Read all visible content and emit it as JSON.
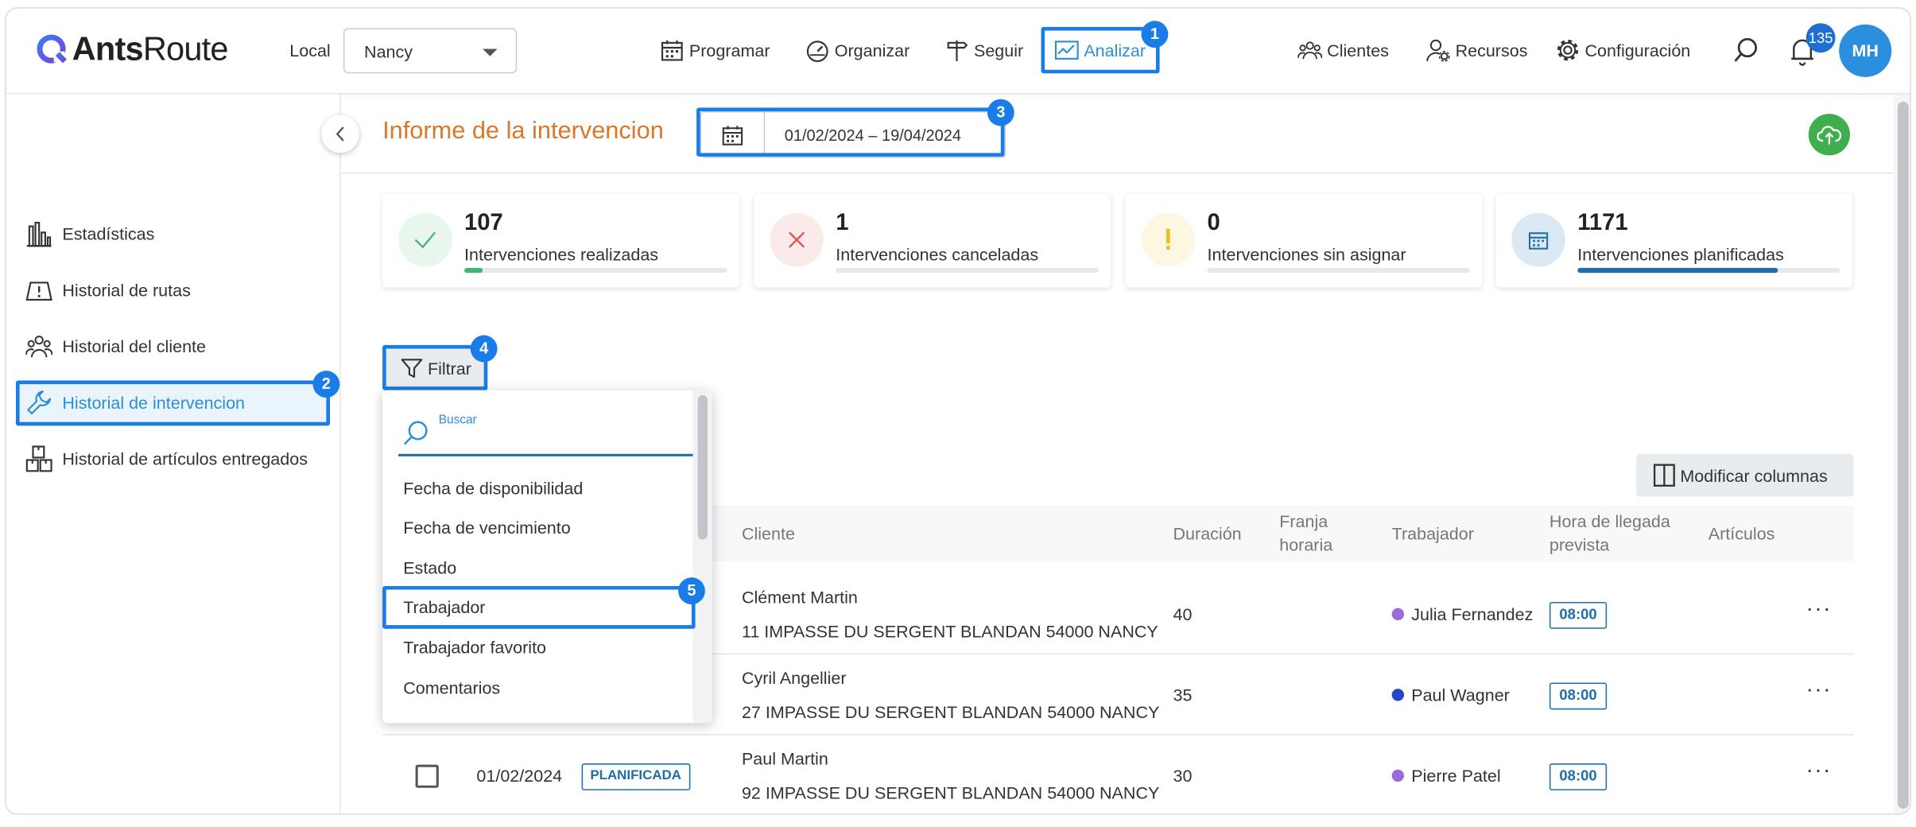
{
  "app": {
    "logo_part1": "Ants",
    "logo_part2": "Route",
    "local_label": "Local",
    "local_value": "Nancy"
  },
  "nav": {
    "programar": "Programar",
    "organizar": "Organizar",
    "seguir": "Seguir",
    "analizar": "Analizar",
    "clientes": "Clientes",
    "recursos": "Recursos",
    "configuracion": "Configuración",
    "notification_count": "135",
    "avatar_initials": "MH"
  },
  "annotations": [
    "1",
    "2",
    "3",
    "4",
    "5"
  ],
  "sidebar": {
    "items": [
      {
        "label": "Estadísticas",
        "icon": "bar-chart-icon"
      },
      {
        "label": "Historial de rutas",
        "icon": "map-icon"
      },
      {
        "label": "Historial del cliente",
        "icon": "users-icon"
      },
      {
        "label": "Historial de intervencion",
        "icon": "wrench-icon"
      },
      {
        "label": "Historial de artículos entregados",
        "icon": "boxes-icon"
      }
    ]
  },
  "page": {
    "title": "Informe de la intervencion",
    "date_range": "01/02/2024 – 19/04/2024"
  },
  "cards": [
    {
      "value": "107",
      "label": "Intervenciones realizadas",
      "color": "#3fb57a",
      "progress": 0.07
    },
    {
      "value": "1",
      "label": "Intervenciones canceladas",
      "color": "#e05050",
      "progress": 0.0
    },
    {
      "value": "0",
      "label": "Intervenciones sin asignar",
      "color": "#e8c020",
      "progress": 0.0
    },
    {
      "value": "1171",
      "label": "Intervenciones planificadas",
      "color": "#1f6ea8",
      "progress": 0.76
    }
  ],
  "filter": {
    "button_label": "Filtrar",
    "search_placeholder": "Buscar",
    "options": [
      "Fecha de disponibilidad",
      "Fecha de vencimiento",
      "Estado",
      "Trabajador",
      "Trabajador favorito",
      "Comentarios"
    ]
  },
  "table": {
    "modify_columns_label": "Modificar columnas",
    "headers": {
      "cliente": "Cliente",
      "duracion": "Duración",
      "franja_1": "Franja",
      "franja_2": "horaria",
      "trabajador": "Trabajador",
      "hora_1": "Hora de llegada",
      "hora_2": "prevista",
      "articulos": "Artículos"
    },
    "rows": [
      {
        "date": "",
        "status": "",
        "client": "Clément Martin",
        "address": "11 IMPASSE DU SERGENT BLANDAN 54000 NANCY",
        "duration": "40",
        "worker": "Julia Fernandez",
        "worker_color": "#9b6bdc",
        "arrival": "08:00"
      },
      {
        "date": "",
        "status": "",
        "client": "Cyril Angellier",
        "address": "27 IMPASSE DU SERGENT BLANDAN 54000 NANCY",
        "duration": "35",
        "worker": "Paul Wagner",
        "worker_color": "#2446c8",
        "arrival": "08:00"
      },
      {
        "date": "01/02/2024",
        "status": "PLANIFICADA",
        "client": "Paul Martin",
        "address": "92 IMPASSE DU SERGENT BLANDAN 54000 NANCY",
        "duration": "30",
        "worker": "Pierre Patel",
        "worker_color": "#9b6bdc",
        "arrival": "08:00"
      }
    ]
  },
  "colors": {
    "accent": "#1a7ce6",
    "title": "#d9772b",
    "active_nav": "#2b8fd6"
  }
}
